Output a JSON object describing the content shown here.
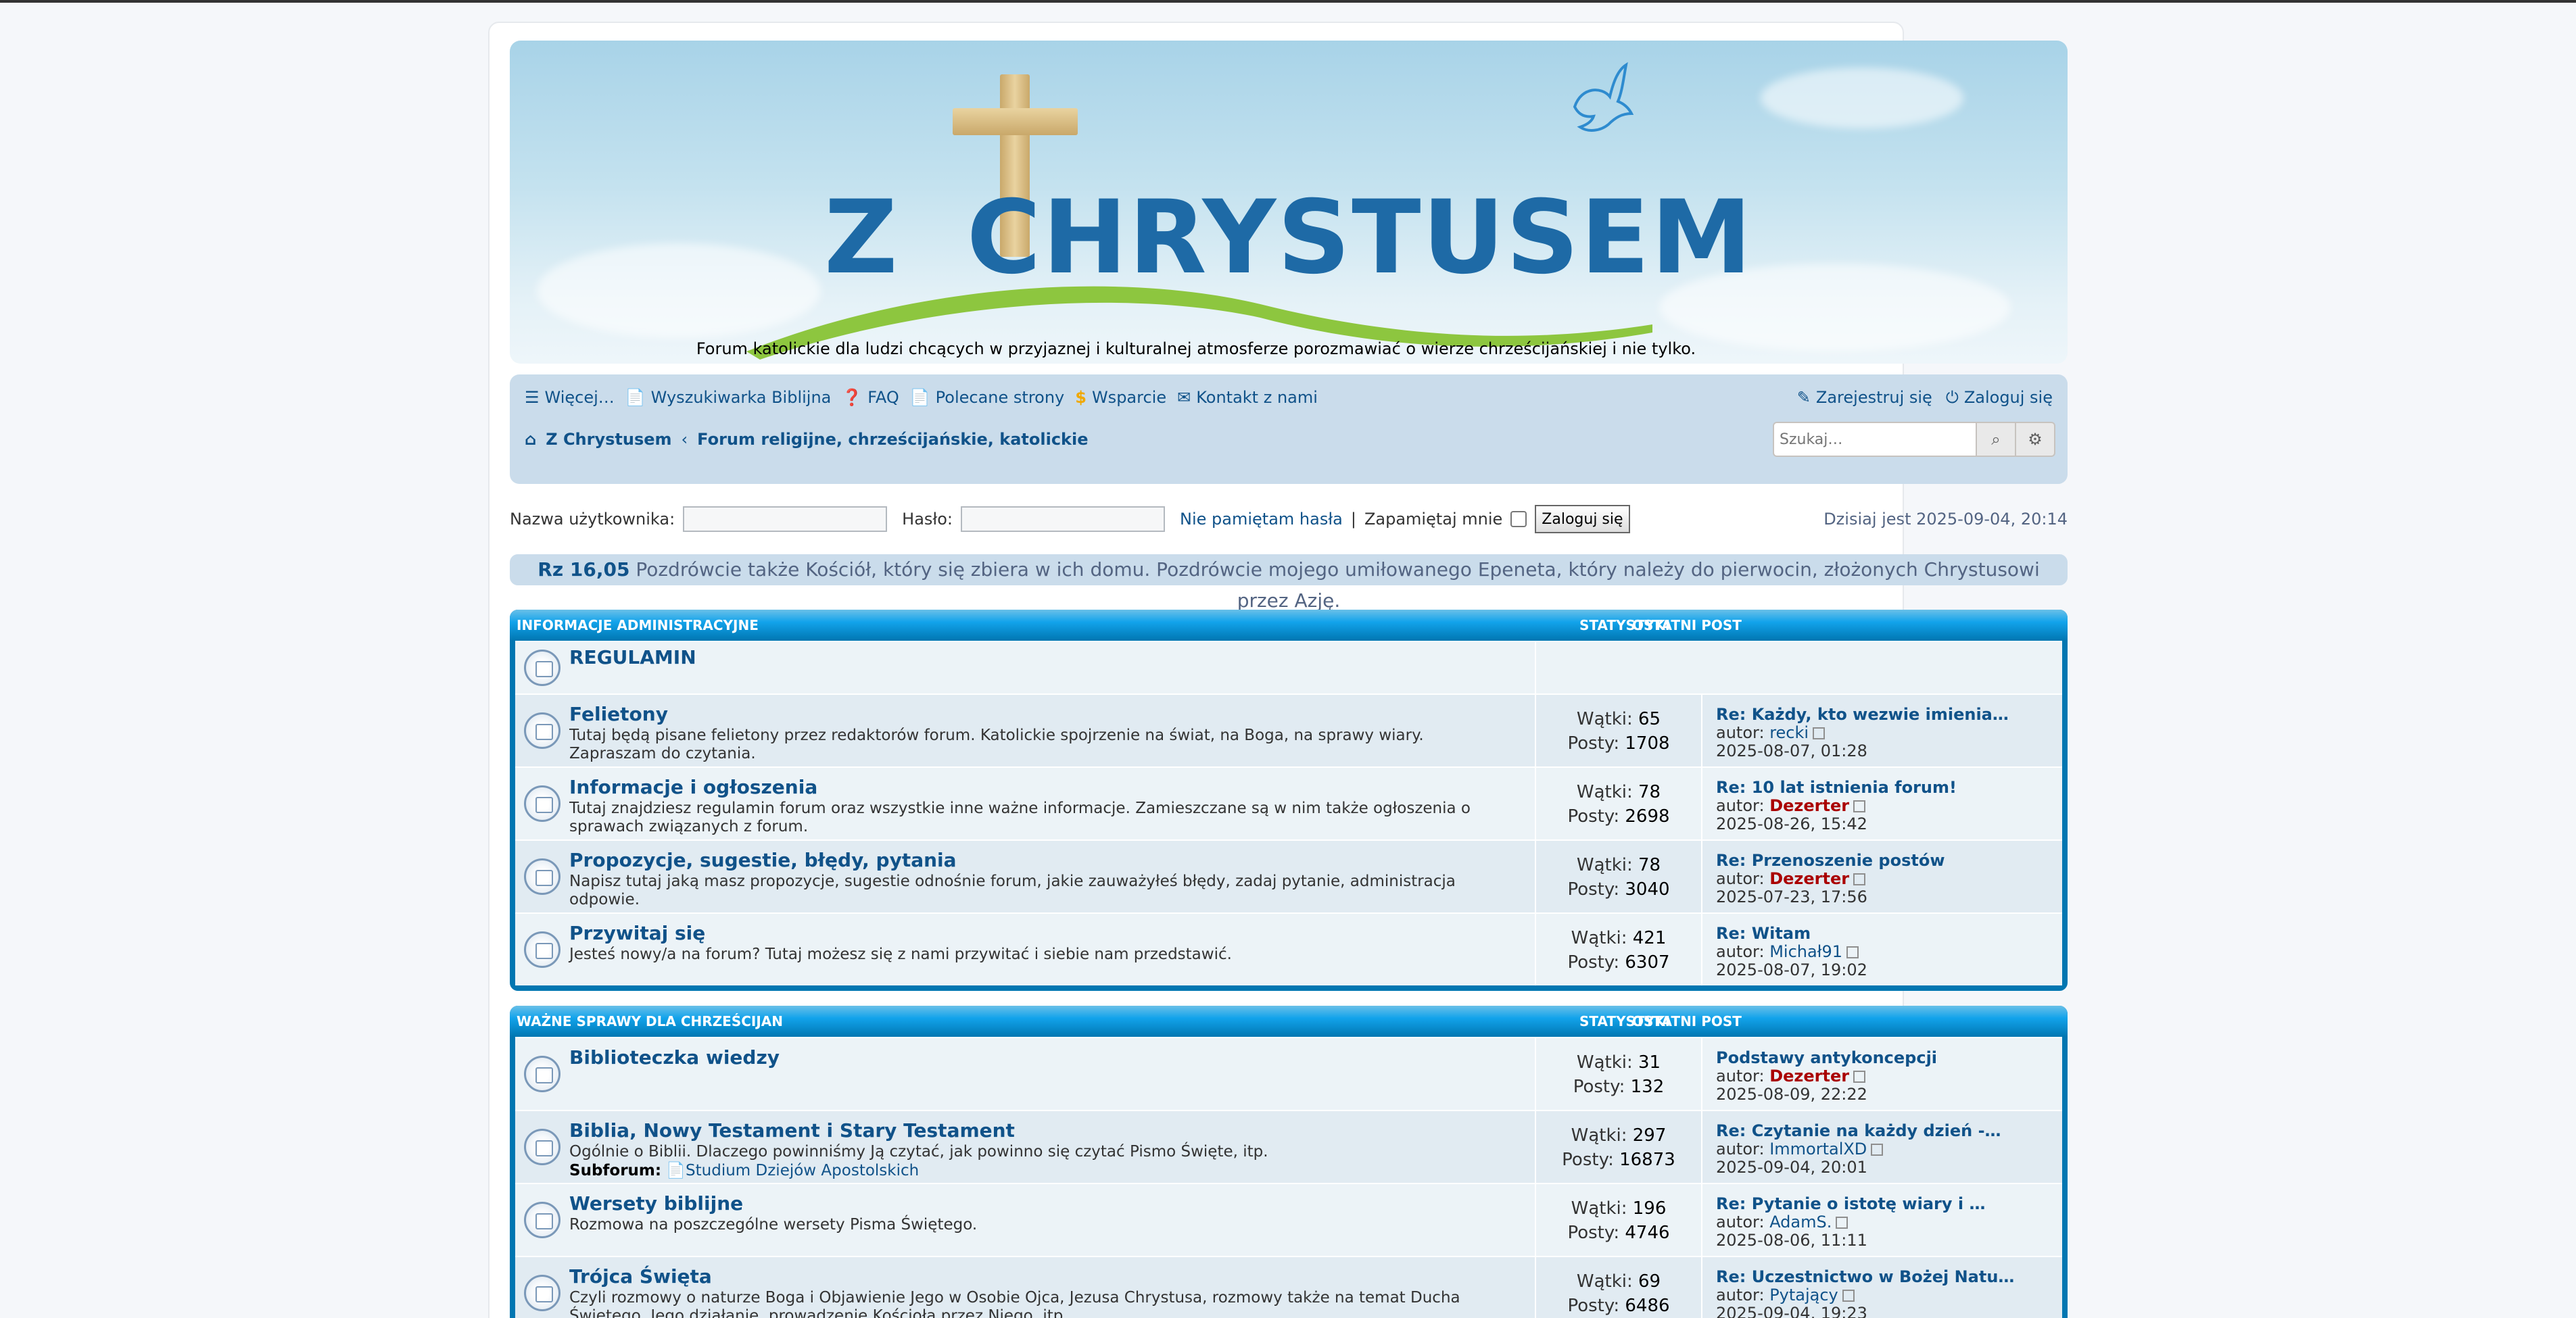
{
  "header": {
    "logo": {
      "text_left": "Z",
      "text_right": "CHRYSTUSEM"
    },
    "site_description": "Forum katolickie dla ludzi chcących w przyjaznej i kulturalnej atmosferze porozmawiać o wierze chrześcijańskiej i nie tylko."
  },
  "nav": {
    "left": [
      {
        "icon": "hamburger-icon",
        "label": "Więcej…"
      },
      {
        "icon": "book-icon",
        "label": "Wyszukiwarka Biblijna"
      },
      {
        "icon": "question-icon",
        "label": "FAQ"
      },
      {
        "icon": "pages-icon",
        "label": "Polecane strony"
      },
      {
        "icon": "dollar-icon",
        "label": "Wsparcie"
      },
      {
        "icon": "mail-icon",
        "label": "Kontakt z nami"
      }
    ],
    "right": [
      {
        "icon": "edit-icon",
        "label": "Zarejestruj się"
      },
      {
        "icon": "power-icon",
        "label": "Zaloguj się"
      }
    ],
    "breadcrumbs": [
      "Z Chrystusem",
      "Forum religijne, chrześcijańskie, katolickie"
    ],
    "search_placeholder": "Szukaj…"
  },
  "login": {
    "username_label": "Nazwa użytkownika:",
    "password_label": "Hasło:",
    "forgot_label": "Nie pamiętam hasła",
    "separator": "|",
    "remember_label": "Zapamiętaj mnie",
    "login_button": "Zaloguj się",
    "today": "Dzisiaj jest 2025-09-04, 20:14"
  },
  "verse": {
    "ref": "Rz 16,05",
    "text": "Pozdrówcie także Kościół, który się zbiera w ich domu. Pozdrówcie mojego umiłowanego Epeneta, który należy do pierwocin, złożonych Chrystusowi przez Azję."
  },
  "categories": [
    {
      "title": "INFORMACJE ADMINISTRACYJNE",
      "stat_header": "STATYSTYKI",
      "last_header": "OSTATNI POST",
      "forums": [
        {
          "name": "REGULAMIN",
          "desc": "",
          "topics": "",
          "posts": "",
          "last_title": "",
          "last_author": "",
          "last_date": "",
          "is_link": true
        },
        {
          "name": "Felietony",
          "desc": "Tutaj będą pisane felietony przez redaktorów forum. Katolickie spojrzenie na świat, na Boga, na sprawy wiary. Zapraszam do czytania.",
          "topics": "65",
          "posts": "1708",
          "last_title": "Re: Każdy, kto wezwie imienia…",
          "last_author": "recki",
          "last_date": "2025-08-07, 01:28"
        },
        {
          "name": "Informacje i ogłoszenia",
          "desc": "Tutaj znajdziesz regulamin forum oraz wszystkie inne ważne informacje. Zamieszczane są w nim także ogłoszenia o sprawach związanych z forum.",
          "topics": "78",
          "posts": "2698",
          "last_title": "Re: 10 lat istnienia forum!",
          "last_author": "Dezerter",
          "last_date": "2025-08-26, 15:42",
          "red": true
        },
        {
          "name": "Propozycje, sugestie, błędy, pytania",
          "desc": "Napisz tutaj jaką masz propozycje, sugestie odnośnie forum, jakie zauważyłeś błędy, zadaj pytanie, administracja odpowie.",
          "topics": "78",
          "posts": "3040",
          "last_title": "Re: Przenoszenie postów",
          "last_author": "Dezerter",
          "last_date": "2025-07-23, 17:56",
          "red": true
        },
        {
          "name": "Przywitaj się",
          "desc": "Jesteś nowy/a na forum? Tutaj możesz się z nami przywitać i siebie nam przedstawić.",
          "topics": "421",
          "posts": "6307",
          "last_title": "Re: Witam",
          "last_author": "Michał91",
          "last_date": "2025-08-07, 19:02"
        }
      ]
    },
    {
      "title": "WAŻNE SPRAWY DLA CHRZEŚCIJAN",
      "stat_header": "STATYSTYKI",
      "last_header": "OSTATNI POST",
      "forums": [
        {
          "name": "Biblioteczka wiedzy",
          "desc": "",
          "topics": "31",
          "posts": "132",
          "last_title": "Podstawy antykoncepcji",
          "last_author": "Dezerter",
          "last_date": "2025-08-09, 22:22",
          "red": true
        },
        {
          "name": "Biblia, Nowy Testament i Stary Testament",
          "desc": "Ogólnie o Biblii. Dlaczego powinniśmy Ją czytać, jak powinno się czytać Pismo Święte, itp.",
          "sub_label": "Subforum:",
          "sub_value": "Studium Dziejów Apostolskich",
          "topics": "297",
          "posts": "16873",
          "last_title": "Re: Czytanie na każdy dzień -…",
          "last_author": "ImmortalXD",
          "last_date": "2025-09-04, 20:01"
        },
        {
          "name": "Wersety biblijne",
          "desc": "Rozmowa na poszczególne wersety Pisma Świętego.",
          "topics": "196",
          "posts": "4746",
          "last_title": "Re: Pytanie o istotę wiary i …",
          "last_author": "AdamS.",
          "last_date": "2025-08-06, 11:11"
        },
        {
          "name": "Trójca Święta",
          "desc": "Czyli rozmowy o naturze Boga i Objawienie Jego w Osobie Ojca, Jezusa Chrystusa, rozmowy także na temat Ducha Świętego, Jego działanie, prowadzenie Kościoła przez Niego, itp.",
          "topics": "69",
          "posts": "6486",
          "last_title": "Re: Uczestnictwo w Bożej Natu…",
          "last_author": "Pytający",
          "last_date": "2025-09-04, 19:23"
        }
      ]
    }
  ],
  "labels": {
    "topics": "Wątki:",
    "posts": "Posty:",
    "author": "autor:"
  }
}
